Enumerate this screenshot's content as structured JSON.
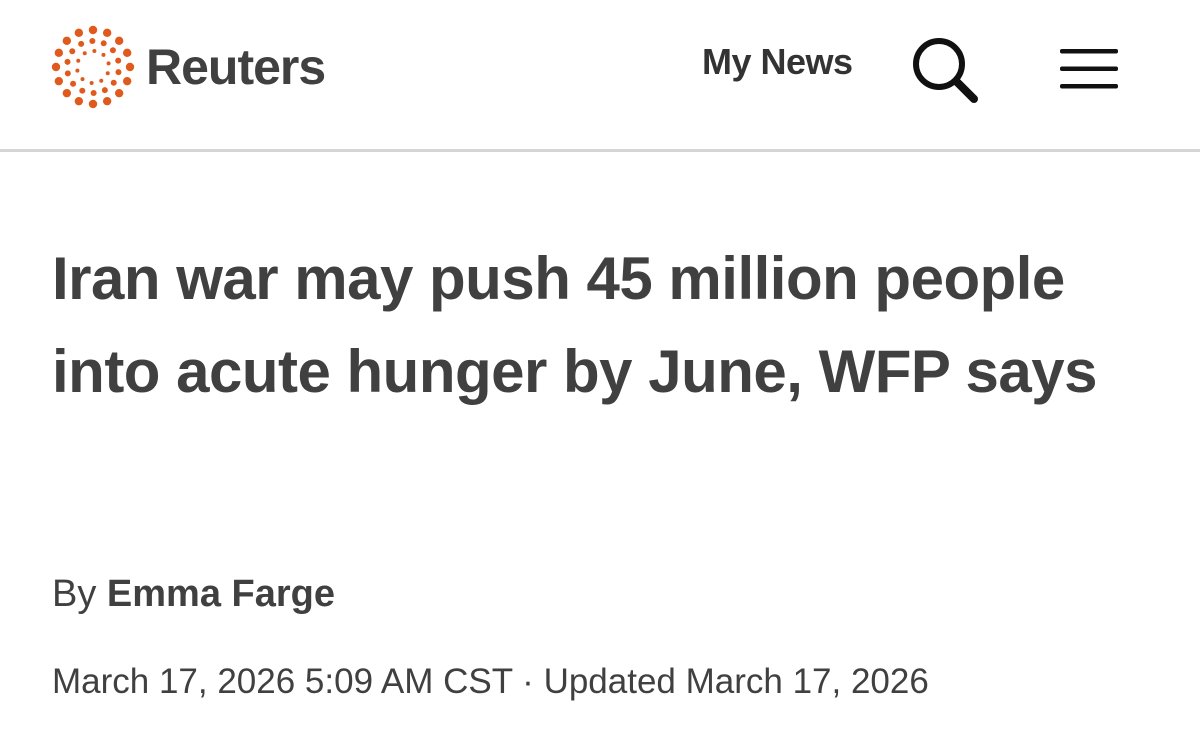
{
  "header": {
    "brand": "Reuters",
    "brand_color": "#e05a1e",
    "my_news_label": "My News",
    "search_icon": "search-icon",
    "menu_icon": "hamburger-menu-icon"
  },
  "article": {
    "headline": "Iran war may push 45 million people into acute hunger by June, WFP says",
    "byline_prefix": "By",
    "author": "Emma Farge",
    "published": "March 17, 2026 5:09 AM CST",
    "separator": "·",
    "updated": "Updated March 17, 2026"
  }
}
